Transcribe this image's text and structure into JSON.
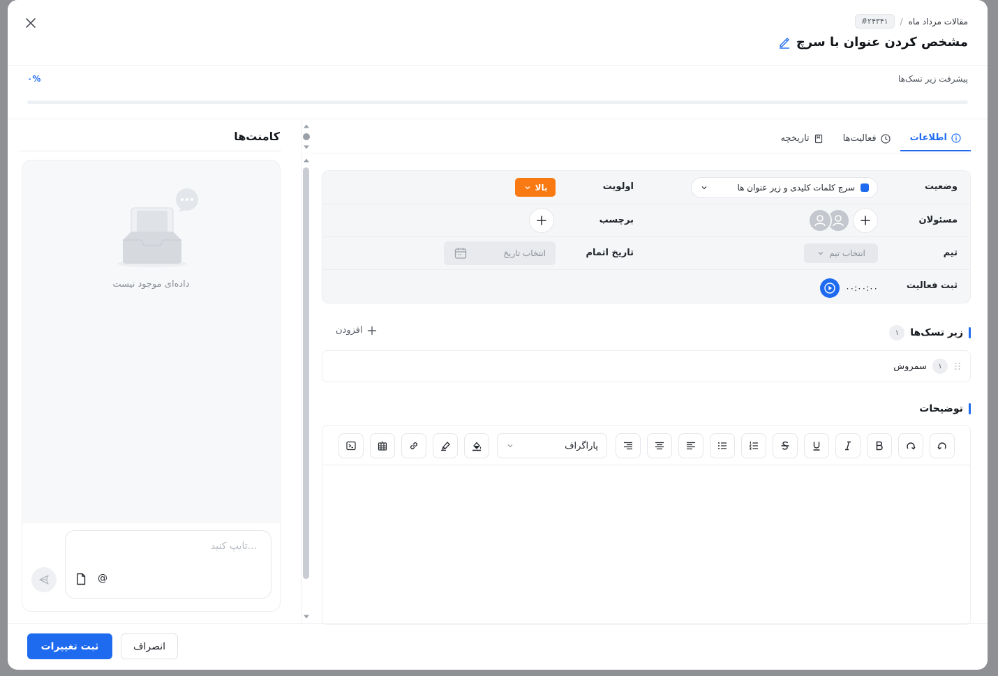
{
  "breadcrumb": {
    "project": "مقالات مرداد ماه",
    "separator": "/",
    "task_id": "#۲۴۳۴۱"
  },
  "task_title": "مشخص کردن عنوان با سرچ",
  "progress": {
    "label": "پیشرفت زیر تسک‌ها",
    "value_text": "۰%",
    "value": 0
  },
  "tabs": [
    {
      "label": "اطلاعات",
      "icon": "info-icon",
      "active": true
    },
    {
      "label": "فعالیت‌ها",
      "icon": "clock-icon",
      "active": false
    },
    {
      "label": "تاریخچه",
      "icon": "bookmark-icon",
      "active": false
    }
  ],
  "info": {
    "status_label": "وضعیت",
    "status_value": "سرچ کلمات کلیدی و زیر عنوان ها",
    "status_color": "#1e6bf0",
    "priority_label": "اولویت",
    "priority_value": "بالا",
    "priority_color": "#f97a12",
    "assignees_label": "مسئولان",
    "tag_label": "برچسب",
    "team_label": "تیم",
    "team_placeholder": "انتخاب تیم",
    "due_label": "تاریخ اتمام",
    "due_placeholder": "انتخاب تاریخ",
    "activity_label": "ثبت فعالیت",
    "timer": "۰۰:۰۰:۰۰"
  },
  "subtasks": {
    "title": "زیر تسک‌ها",
    "count": "۱",
    "add_label": "افزودن",
    "items": [
      {
        "index": "۱",
        "title": "سمروش"
      }
    ]
  },
  "description": {
    "title": "توضیحات",
    "paragraph_select": "پاراگراف",
    "toolbar_icons": [
      "undo-icon",
      "redo-icon",
      "bold-icon",
      "italic-icon",
      "underline-icon",
      "strikethrough-icon",
      "ordered-list-icon",
      "bullet-list-icon",
      "align-right-icon",
      "align-center-icon",
      "align-left-icon",
      "fill-color-icon",
      "highlighter-icon",
      "link-icon",
      "table-icon",
      "code-block-icon"
    ]
  },
  "comments": {
    "title": "کامنت‌ها",
    "empty_text": "داده‌ای موجود نیست",
    "input_placeholder": "تایپ کنید...",
    "mention_symbol": "@"
  },
  "footer": {
    "save_label": "ثبت تغییرات",
    "cancel_label": "انصراف"
  },
  "colors": {
    "accent": "#1e6bf0",
    "priority": "#f97a12"
  }
}
